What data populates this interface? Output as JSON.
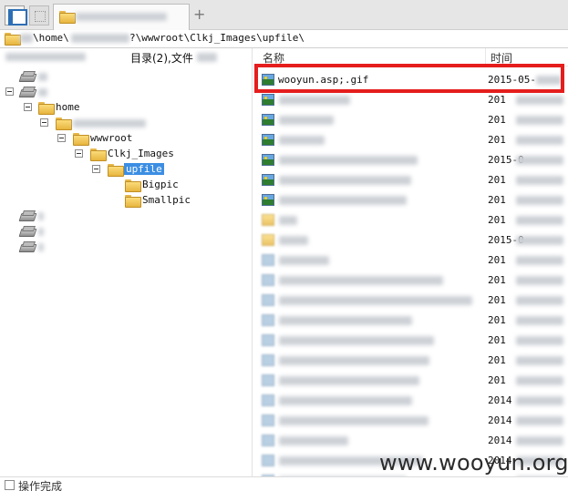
{
  "path": {
    "segment_home": "\\home\\",
    "segment_tail": "?\\wwwroot\\Clkj_Images\\upfile\\"
  },
  "left_pane": {
    "stats": "目录(2),文件",
    "tree": {
      "home": "home",
      "wwwroot": "wwwroot",
      "clkj_images": "Clkj_Images",
      "upfile": "upfile",
      "bigpic": "Bigpic",
      "smallpic": "Smallpic"
    }
  },
  "file_list": {
    "col_name": "名称",
    "col_time": "时间",
    "highlighted_row": {
      "name": "wooyun.asp;.gif",
      "time": "2015-05-"
    },
    "rows": [
      {
        "icon": "image-file-icon",
        "time": "201"
      },
      {
        "icon": "image-file-icon",
        "time": "201"
      },
      {
        "icon": "image-file-icon",
        "time": "201"
      },
      {
        "icon": "image-file-icon",
        "time": "2015-0"
      },
      {
        "icon": "image-file-icon",
        "time": "201"
      },
      {
        "icon": "image-file-icon",
        "time": "201"
      },
      {
        "icon": "folder-icon",
        "time": "201"
      },
      {
        "icon": "folder-icon",
        "time": "2015-0"
      },
      {
        "icon": "file-icon",
        "time": "201"
      },
      {
        "icon": "file-icon",
        "time": "201"
      },
      {
        "icon": "file-icon",
        "time": "201"
      },
      {
        "icon": "file-icon",
        "time": "201"
      },
      {
        "icon": "file-icon",
        "time": "201"
      },
      {
        "icon": "file-icon",
        "time": "201"
      },
      {
        "icon": "file-icon",
        "time": "201"
      },
      {
        "icon": "file-icon",
        "time": "2014"
      },
      {
        "icon": "file-icon",
        "time": "2014"
      },
      {
        "icon": "file-icon",
        "time": "2014"
      },
      {
        "icon": "file-icon",
        "time": "2014"
      },
      {
        "icon": "file-icon",
        "time": "2014"
      }
    ]
  },
  "status": {
    "text": "操作完成"
  },
  "watermark": "www.wooyun.org",
  "colors": {
    "highlight_border": "#e51d1d",
    "selected_folder": "#3c8ee3"
  }
}
